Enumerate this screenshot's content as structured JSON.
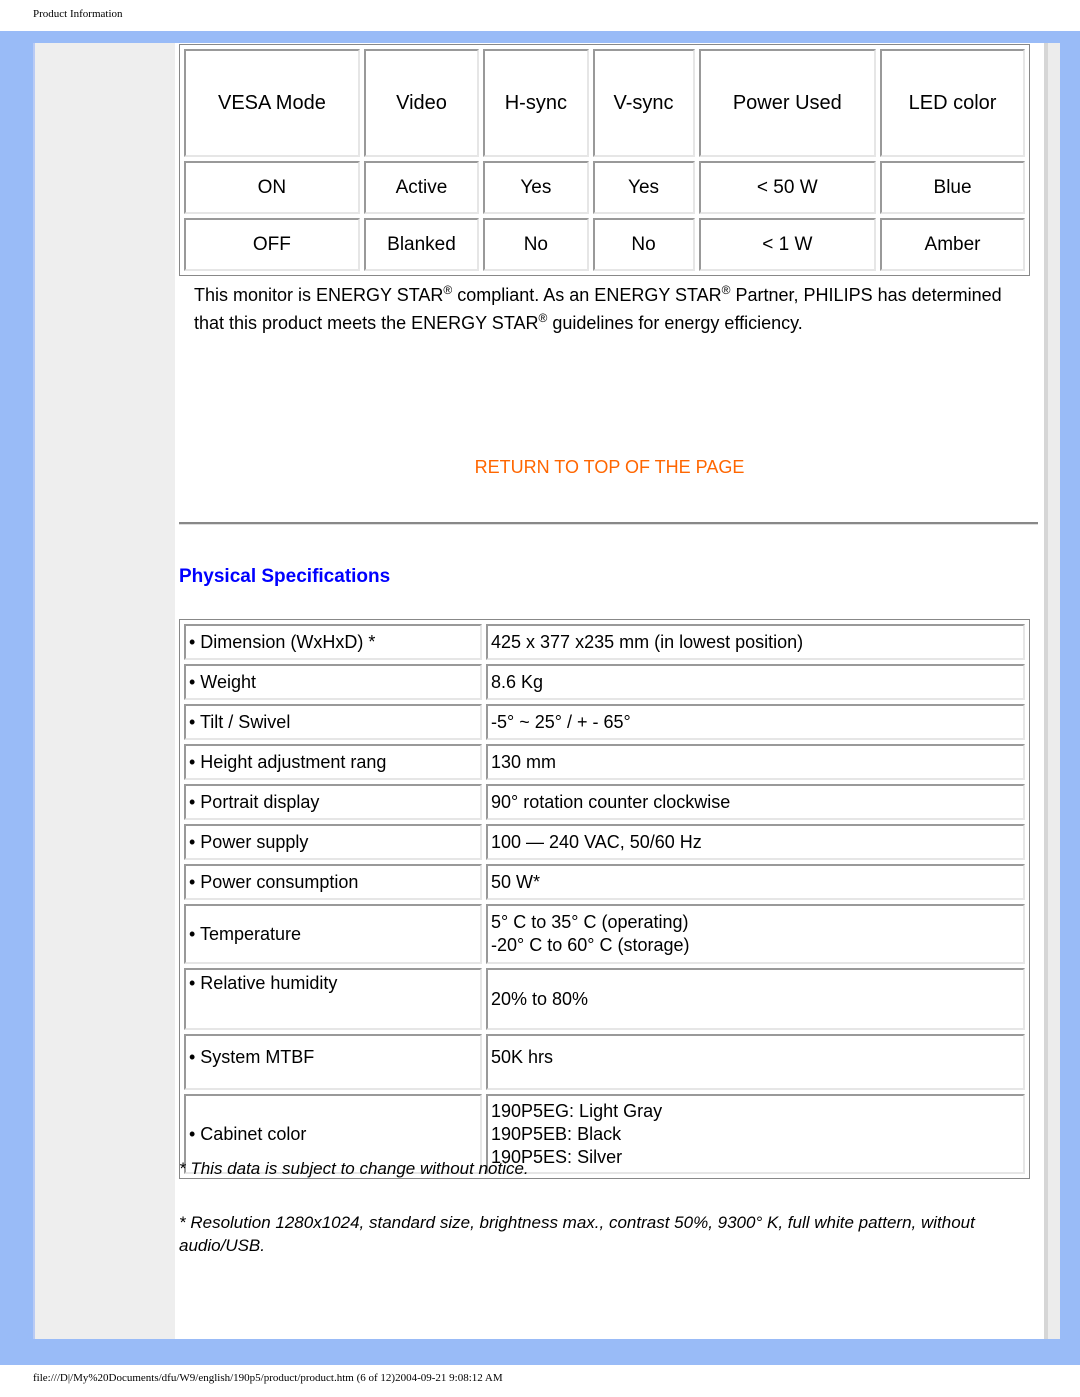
{
  "header": {
    "title": "Product Information"
  },
  "power_table": {
    "headers": [
      "VESA Mode",
      "Video",
      "H-sync",
      "V-sync",
      "Power Used",
      "LED color"
    ],
    "rows": [
      [
        "ON",
        "Active",
        "Yes",
        "Yes",
        "< 50 W",
        "Blue"
      ],
      [
        "OFF",
        "Blanked",
        "No",
        "No",
        "< 1 W",
        "Amber"
      ]
    ]
  },
  "energy_star": {
    "p1": "This monitor is ENERGY STAR",
    "p2": " compliant. As an ENERGY STAR",
    "p3": " Partner, PHILIPS has determined that this product meets the ENERGY STAR",
    "p4": " guidelines for energy efficiency.",
    "reg": "®"
  },
  "return_link": {
    "label": "RETURN TO TOP OF THE PAGE",
    "color": "#ff6600"
  },
  "physical": {
    "title": "Physical Specifications",
    "title_color": "#0000ff",
    "rows": [
      {
        "key": "• Dimension (WxHxD) *",
        "value": [
          "425 x 377 x235 mm (in lowest position)"
        ]
      },
      {
        "key": "• Weight",
        "value": [
          "8.6 Kg"
        ]
      },
      {
        "key": "• Tilt / Swivel",
        "value": [
          "-5° ~ 25° / + - 65°"
        ]
      },
      {
        "key": "• Height adjustment rang",
        "value": [
          "130 mm"
        ]
      },
      {
        "key": "• Portrait display",
        "value": [
          "90° rotation counter clockwise"
        ]
      },
      {
        "key": "• Power supply",
        "value": [
          "100 — 240 VAC, 50/60 Hz"
        ]
      },
      {
        "key": "• Power consumption",
        "value": [
          "50 W*"
        ]
      },
      {
        "key": "• Temperature",
        "value": [
          "5° C to 35° C (operating)",
          "-20° C to 60° C (storage)"
        ]
      },
      {
        "key": "• Relative humidity",
        "value": [
          "20% to 80%"
        ]
      },
      {
        "key": "• System MTBF",
        "value": [
          "50K hrs"
        ]
      },
      {
        "key": "• Cabinet color",
        "value": [
          "190P5EG: Light Gray",
          "190P5EB: Black",
          "190P5ES: Silver"
        ]
      }
    ]
  },
  "notes": {
    "n1": "* This data is subject to change without notice.",
    "n2": "* Resolution 1280x1024, standard size, brightness max., contrast 50%, 9300° K, full white pattern, without audio/USB."
  },
  "footer": {
    "path": "file:///D|/My%20Documents/dfu/W9/english/190p5/product/product.htm (6 of 12)2004-09-21 9:08:12 AM"
  }
}
